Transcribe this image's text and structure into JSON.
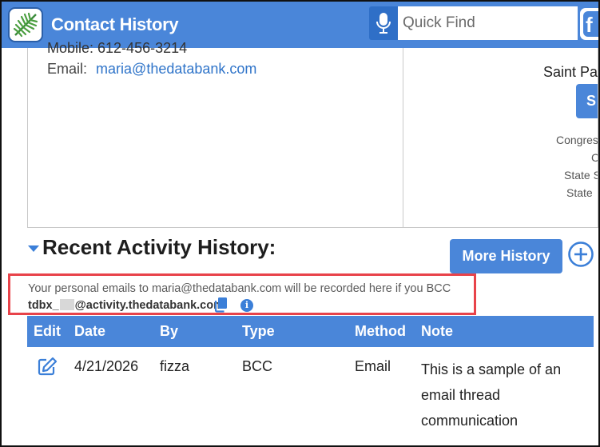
{
  "header": {
    "title": "Contact History",
    "search_placeholder": "Quick Find",
    "facebook_glyph": "f"
  },
  "contact": {
    "mobile_partial": "Mobile:  612-456-3214",
    "email_label": "Email:",
    "email_value": "maria@thedatabank.com",
    "city_partial": "Saint Pa",
    "map_button_partial": "S",
    "labels_partial": [
      "Congres",
      "C",
      "State S",
      "State"
    ]
  },
  "activity": {
    "title": "Recent Activity History:",
    "more_button": "More History",
    "notice_line1": "Your personal emails to maria@thedatabank.com will be recorded here if you BCC",
    "notice_prefix": "tdbx_",
    "notice_suffix": "@activity.thedatabank.com.",
    "info_glyph": "i",
    "columns": [
      "Edit",
      "Date",
      "By",
      "Type",
      "Method",
      "Note"
    ],
    "rows": [
      {
        "date": "4/21/2026",
        "by": "fizza",
        "type": "BCC",
        "method": "Email",
        "note": "This is a sample of an email thread communication"
      }
    ]
  },
  "colors": {
    "brand_blue": "#4a86d9",
    "link_blue": "#2f74c9",
    "highlight_red": "#e8434a"
  },
  "icons": [
    "fern-logo-icon",
    "microphone-icon",
    "facebook-icon",
    "caret-down-icon",
    "plus-circle-icon",
    "copy-icon",
    "info-icon",
    "edit-icon"
  ]
}
